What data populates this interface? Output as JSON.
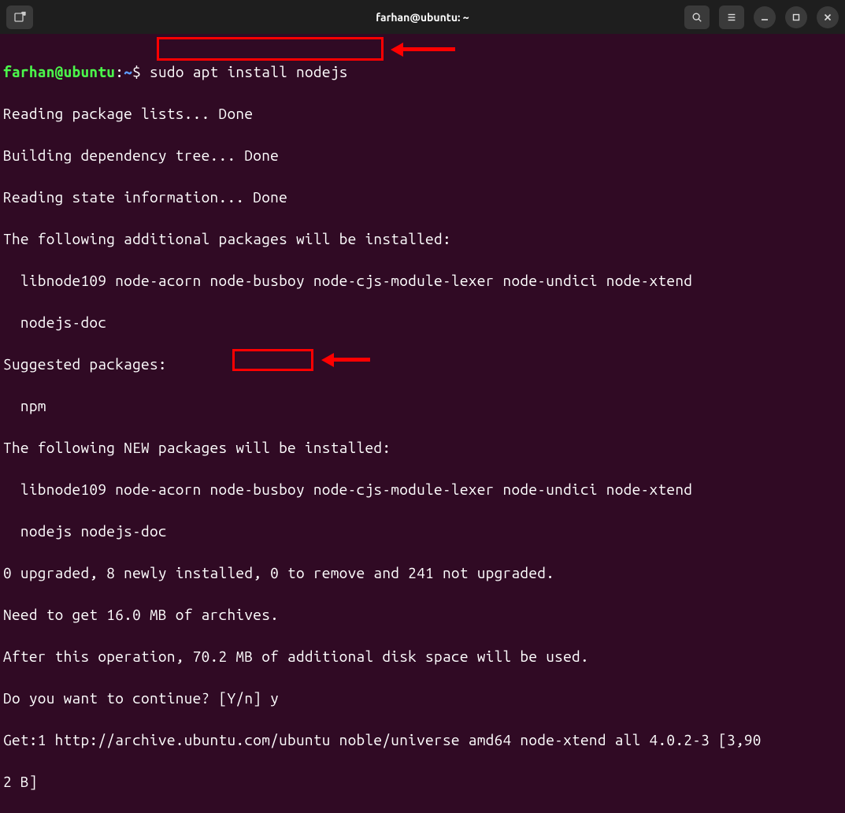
{
  "titlebar": {
    "title": "farhan@ubuntu: ~"
  },
  "prompt": {
    "user_host": "farhan@ubuntu",
    "sep": ":",
    "path": "~",
    "dollar": "$ ",
    "command": "sudo apt install nodejs"
  },
  "output": {
    "l1": "Reading package lists... Done",
    "l2": "Building dependency tree... Done",
    "l3": "Reading state information... Done",
    "l4": "The following additional packages will be installed:",
    "l5": "  libnode109 node-acorn node-busboy node-cjs-module-lexer node-undici node-xtend",
    "l6": "  nodejs-doc",
    "l7": "Suggested packages:",
    "l8": "  npm",
    "l9": "The following NEW packages will be installed:",
    "l10": "  libnode109 node-acorn node-busboy node-cjs-module-lexer node-undici node-xtend",
    "l11": "  nodejs nodejs-doc",
    "l12": "0 upgraded, 8 newly installed, 0 to remove and 241 not upgraded.",
    "l13": "Need to get 16.0 MB of archives.",
    "l14": "After this operation, 70.2 MB of additional disk space will be used.",
    "l15": "Do you want to continue? [Y/n] y",
    "l16": "Get:1 http://archive.ubuntu.com/ubuntu noble/universe amd64 node-xtend all 4.0.2-3 [3,90",
    "l17": "2 B]"
  }
}
